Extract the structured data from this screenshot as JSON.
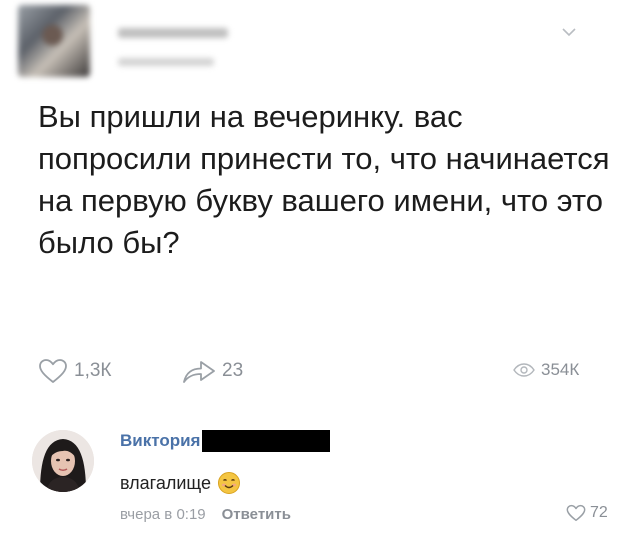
{
  "post": {
    "text": "Вы пришли на вечеринку. вас попросили принести то, что начинается на первую букву вашего имени, что это было бы?",
    "likes": "1,3К",
    "reposts": "23",
    "views": "354К"
  },
  "comment": {
    "author": "Виктория",
    "text": "влагалище",
    "time": "вчера в 0:19",
    "reply_label": "Ответить",
    "likes": "72",
    "emoji": "smiling-face-icon"
  },
  "colors": {
    "link": "#4a72a8",
    "muted": "#8a8f96",
    "text": "#1c1c1c"
  }
}
